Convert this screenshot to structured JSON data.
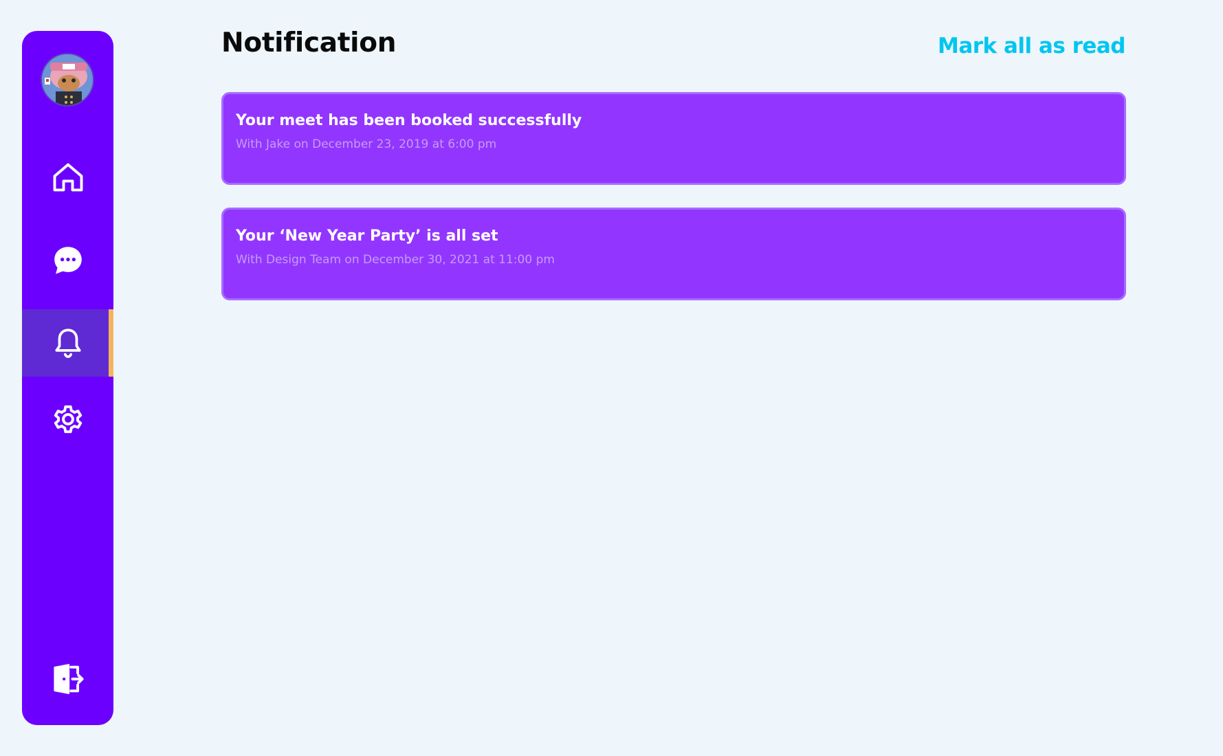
{
  "header": {
    "title": "Notification",
    "mark_all_label": "Mark all as read"
  },
  "sidebar": {
    "avatar": "profile-avatar",
    "items": [
      {
        "icon": "home-icon",
        "label": "Home",
        "active": false
      },
      {
        "icon": "chat-icon",
        "label": "Messages",
        "active": false
      },
      {
        "icon": "bell-icon",
        "label": "Notifications",
        "active": true
      },
      {
        "icon": "gear-icon",
        "label": "Settings",
        "active": false
      }
    ],
    "logout_icon": "logout-icon"
  },
  "notifications": [
    {
      "title": "Your meet has been booked successfully",
      "subtitle": "With Jake on December 23, 2019 at 6:00 pm"
    },
    {
      "title": "Your ‘New Year Party’ is all set",
      "subtitle": "With Design Team on December 30, 2021 at 11:00 pm"
    }
  ],
  "colors": {
    "background": "#eef5fb",
    "sidebar": "#6c00ff",
    "sidebar_active": "#5f2ad3",
    "active_indicator": "#f6b35d",
    "card": "#9236ff",
    "card_border": "#a66cff",
    "accent": "#00c6ef"
  }
}
